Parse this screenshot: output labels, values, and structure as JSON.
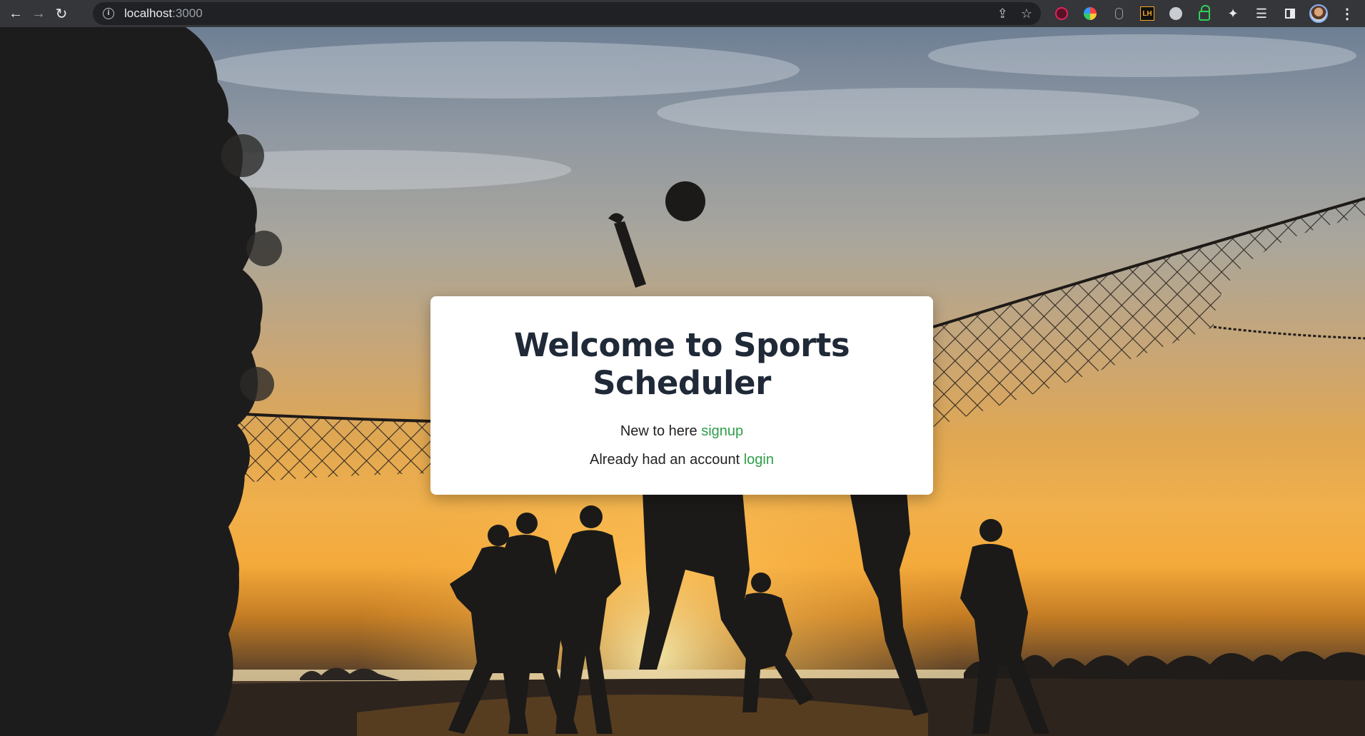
{
  "browser": {
    "url_host": "localhost",
    "url_port": ":3000",
    "nav": {
      "back": "←",
      "forward": "→",
      "reload": "↻"
    },
    "icons": [
      "info-icon",
      "share-icon",
      "star-icon",
      "extensions-puzzle-icon",
      "reading-list-icon",
      "side-panel-icon",
      "profile-avatar",
      "menu-icon"
    ],
    "ext_lh_label": "LH"
  },
  "hero": {
    "theme_colors": {
      "sky_top": "#6e7f94",
      "sunset": "#f4a93a",
      "silhouette": "#1b1a19"
    }
  },
  "card": {
    "title": "Welcome to Sports Scheduler",
    "signup_prefix": "New to here ",
    "signup_link": "signup",
    "login_prefix": "Already had an account ",
    "login_link": "login",
    "link_color": "#2e9e48"
  }
}
